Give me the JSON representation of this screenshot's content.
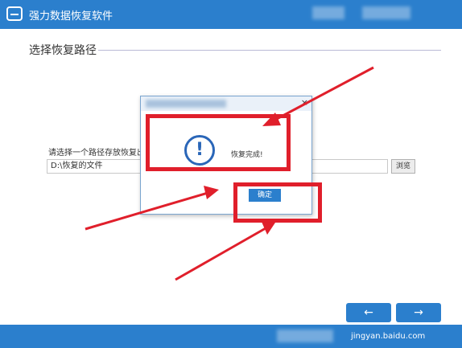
{
  "window": {
    "title": "强力数据恢复软件"
  },
  "section": {
    "title": "选择恢复路径"
  },
  "path_form": {
    "label": "请选择一个路径存放恢复出的文",
    "value": "D:\\恢复的文件",
    "browse_label": "浏览"
  },
  "dialog": {
    "close_glyph": "×",
    "icon_glyph": "!",
    "message": "恢复完成!",
    "ok_label": "确定"
  },
  "nav": {
    "back_label": "←",
    "next_label": "→"
  },
  "watermark": {
    "text": "jingyan.baidu.com"
  },
  "colors": {
    "brand": "#2b7fcd",
    "annotation_red": "#e01f2b",
    "icon_blue": "#2a66b8"
  }
}
